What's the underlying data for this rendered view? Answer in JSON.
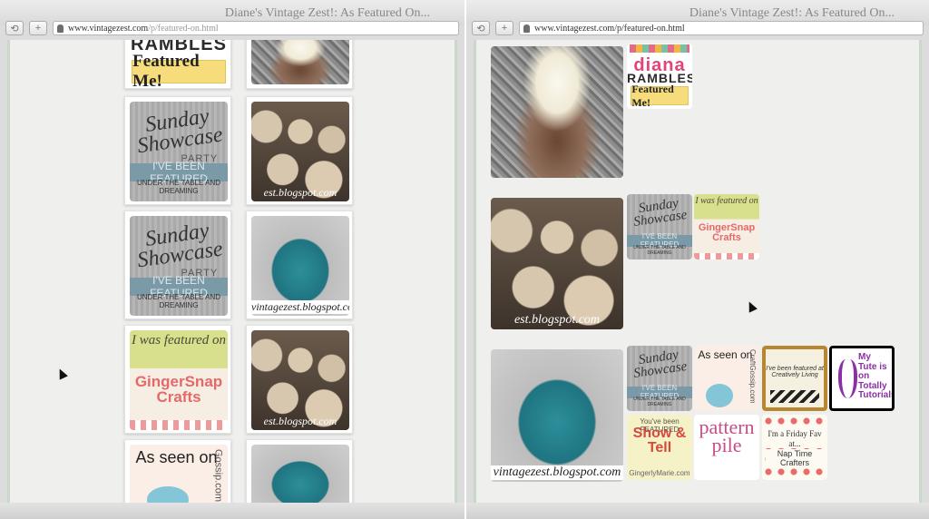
{
  "left_window": {
    "title": "Diane's Vintage Zest!: As Featured On...",
    "url_host": "www.vintagezest.com",
    "url_path": "/p/featured-on.html",
    "badges": {
      "rambles_top": "RAMBLES",
      "rambles_bottom": "Featured Me!",
      "sunday_script": "Sunday Showcase",
      "sunday_party": "PARTY",
      "sunday_banner": "I'VE BEEN FEATURED",
      "sunday_sub": "UNDER THE TABLE AND DREAMING",
      "ginger_top": "I was featured on",
      "ginger_name": "GingerSnap Crafts",
      "craft_as_seen": "As seen on",
      "craft_site": "Gossip.com"
    },
    "captions": {
      "cupcakes": "est.blogspot.com",
      "bag": "vintagezest.blogspot.com"
    }
  },
  "right_window": {
    "title": "Diane's Vintage Zest!: As Featured On...",
    "url_host": "www.vintagezest.com",
    "url_path": "/p/featured-on.html",
    "badges": {
      "diana_name": "diana",
      "diana_rambles": "RAMBLES",
      "diana_featured": "Featured Me!",
      "sunday_script": "Sunday Showcase",
      "sunday_banner": "I'VE BEEN FEATURED",
      "sunday_sub": "UNDER THE TABLE AND DREAMING",
      "ginger_top": "I was featured on",
      "ginger_name": "GingerSnap Crafts",
      "craft_as_seen": "As seen on",
      "craft_site": "CraftGossip.com",
      "creatively_living": "I've been featured at Creatively Living",
      "totally_top": "My Tute is on Totally Tutorials",
      "show_tell_top": "You've been FEATURED",
      "show_tell_main": "Show & Tell",
      "show_tell_site": "GingerlyMarie.com",
      "pattern_pile": "pattern pile",
      "friday_fav": "I'm a Friday Fav at...",
      "nap_time": "Nap Time Crafters"
    },
    "captions": {
      "cupcakes": "est.blogspot.com",
      "bag": "vintagezest.blogspot.com"
    }
  },
  "icons": {
    "back": "back-icon",
    "add": "plus-icon",
    "lock": "lock-icon",
    "cursor": "mouse-cursor-icon"
  }
}
